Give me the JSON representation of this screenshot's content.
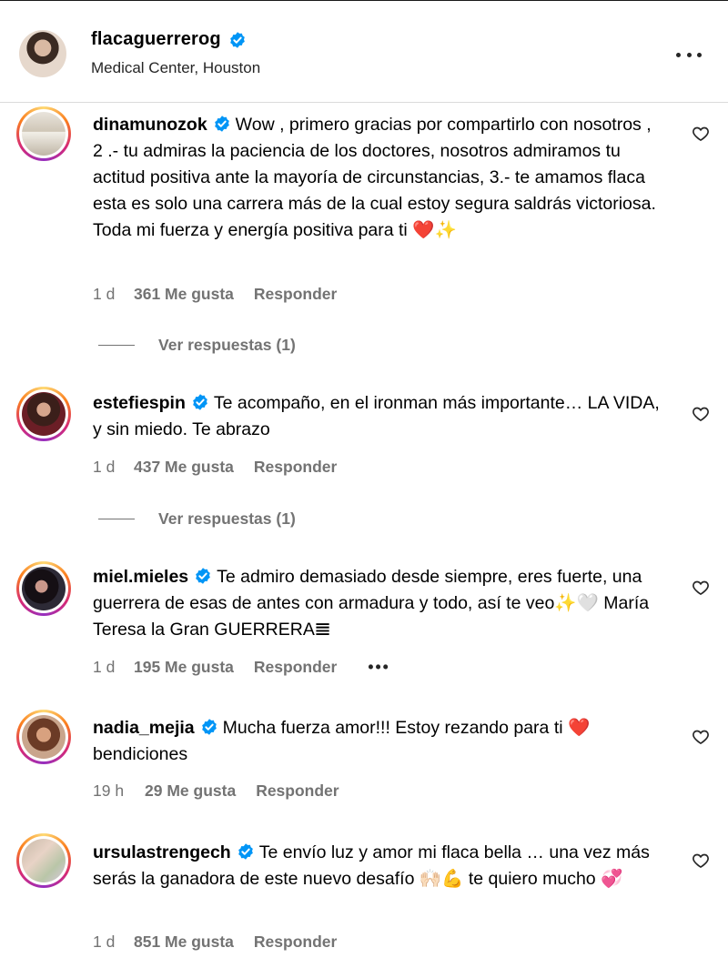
{
  "post": {
    "username": "flacaguerrerog",
    "location": "Medical Center, Houston"
  },
  "comments": [
    {
      "username": "dinamunozok",
      "text": "Wow , primero gracias por compartirlo con nosotros , 2 .- tu admiras la paciencia de los doctores, nosotros admiramos tu actitud positiva ante la mayoría de circunstancias, 3.- te amamos flaca esta es solo una carrera más de la cual estoy segura saldrás victoriosa. Toda mi fuerza y energía positiva para ti ",
      "emoji": "❤️✨",
      "time": "1 d",
      "likes": "361 Me gusta",
      "reply": "Responder",
      "view_replies": "Ver respuestas (1)"
    },
    {
      "username": "estefiespin",
      "text": "Te acompaño, en el ironman más importante… LA VIDA, y sin miedo. Te abrazo",
      "emoji": "",
      "time": "1 d",
      "likes": "437 Me gusta",
      "reply": "Responder",
      "view_replies": "Ver respuestas (1)"
    },
    {
      "username": "miel.mieles",
      "text": "Te admiro demasiado desde siempre, eres fuerte, una guerrera de esas de antes con armadura y todo, así te veo",
      "emoji": "✨🤍",
      "text_after": " María Teresa la Gran GUERRERA",
      "emoji_after": "𝌆",
      "time": "1 d",
      "likes": "195 Me gusta",
      "reply": "Responder",
      "more": "•••"
    },
    {
      "username": "nadia_mejia",
      "text": "Mucha fuerza amor!!! Estoy rezando para ti ",
      "emoji": "❤️",
      "text_after": " bendiciones",
      "time": "19 h",
      "likes": "29 Me gusta",
      "reply": "Responder"
    },
    {
      "username": "ursulastrengech",
      "text": "Te envío luz y amor mi flaca bella … una vez más serás la ganadora de este nuevo desafío ",
      "emoji": "🙌🏻💪",
      "text_after": " te quiero mucho ",
      "emoji_after": "💞",
      "time": "1 d",
      "likes": "851 Me gusta",
      "reply": "Responder"
    }
  ],
  "icons": {
    "verified": "verified-badge-icon",
    "heart": "heart-outline-icon",
    "more": "more-options-icon"
  },
  "colors": {
    "verified_blue": "#0095f6",
    "meta_gray": "#737373",
    "divider": "#dbdbdb"
  }
}
